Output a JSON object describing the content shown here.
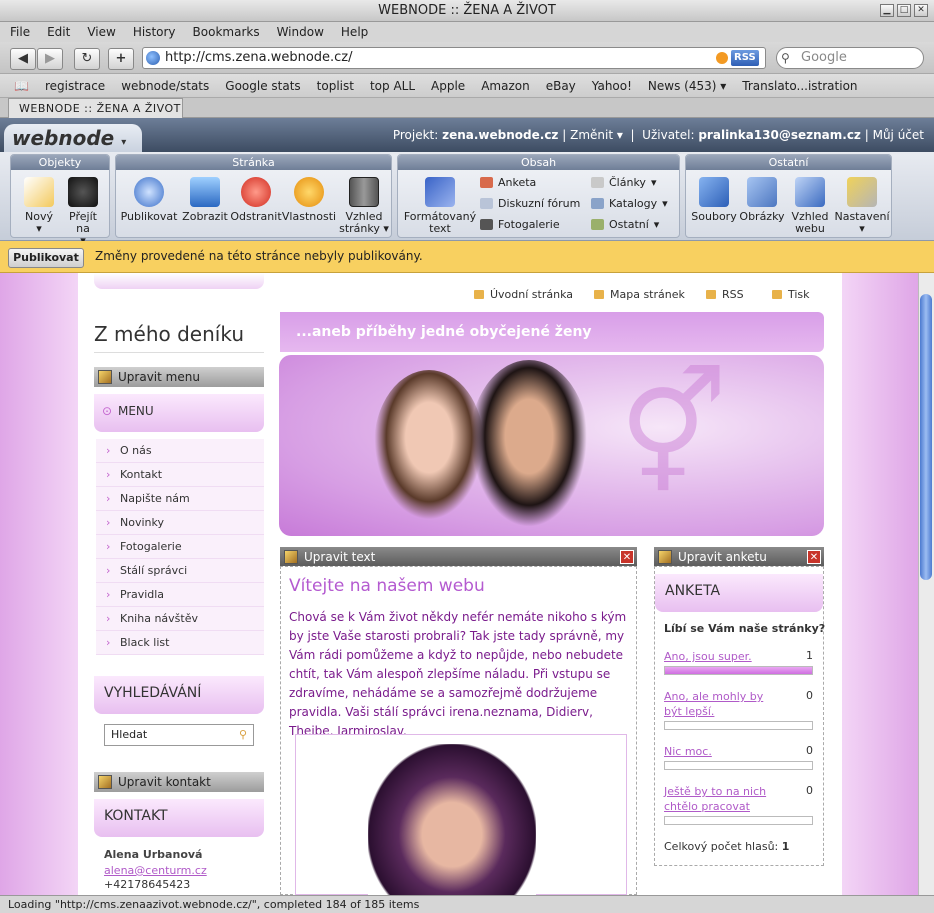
{
  "window": {
    "title": "WEBNODE :: ŽENA A ŽIVOT"
  },
  "menubar": [
    "File",
    "Edit",
    "View",
    "History",
    "Bookmarks",
    "Window",
    "Help"
  ],
  "nav": {
    "url": "http://cms.zena.webnode.cz/",
    "rss": "RSS",
    "search_placeholder": "Google"
  },
  "bookmarks": [
    "registrace",
    "webnode/stats",
    "Google stats",
    "toplist",
    "top ALL",
    "Apple",
    "Amazon",
    "eBay",
    "Yahoo!",
    "News (453) ▾",
    "Translato...istration"
  ],
  "tab": {
    "label": "WEBNODE :: ŽENA A ŽIVOT"
  },
  "webnode": {
    "logo": "webnode",
    "project_label": "Projekt:",
    "project": "zena.webnode.cz",
    "change": "Změnit",
    "user_label": "Uživatel:",
    "user": "pralinka130@seznam.cz",
    "account": "Můj účet"
  },
  "ribbon": {
    "objekty": {
      "title": "Objekty",
      "items": [
        "Nový",
        "Přejít na"
      ]
    },
    "stranka": {
      "title": "Stránka",
      "items": [
        "Publikovat",
        "Zobrazit",
        "Odstranit",
        "Vlastnosti",
        "Vzhled stránky"
      ]
    },
    "obsah": {
      "title": "Obsah",
      "big": "Formátovaný text",
      "col1": [
        "Anketa",
        "Diskuzní fórum",
        "Fotogalerie"
      ],
      "col2": [
        "Články",
        "Katalogy",
        "Ostatní"
      ]
    },
    "ostatni": {
      "title": "Ostatní",
      "items": [
        "Soubory",
        "Obrázky",
        "Vzhled webu",
        "Nastavení"
      ]
    }
  },
  "notice": {
    "button": "Publikovat",
    "text": "Změny provedené na této stránce nebyly publikovány."
  },
  "site": {
    "toplinks": [
      "Úvodní stránka",
      "Mapa stránek",
      "RSS",
      "Tisk"
    ],
    "title": "Z mého deníku",
    "slogan": "...aneb příběhy jedné obyčejené ženy",
    "edit_menu": "Upravit menu",
    "menu_title": "MENU",
    "menu": [
      "O nás",
      "Kontakt",
      "Napište nám",
      "Novinky",
      "Fotogalerie",
      "Stálí správci",
      "Pravidla",
      "Kniha návštěv",
      "Black list"
    ],
    "search_title": "VYHLEDÁVÁNÍ",
    "search_value": "Hledat",
    "edit_contact": "Upravit kontakt",
    "contact_title": "KONTAKT",
    "contact_name": "Alena Urbanová",
    "contact_email": "alena@centurm.cz",
    "contact_phone": "+42178645423",
    "edit_text": "Upravit text",
    "welcome": "Vítejte na našem webu",
    "body": "Chová se k Vám život někdy nefér nemáte nikoho s kým by jste Vaše starosti probrali? Tak jste tady správně, my Vám rádi pomůžeme a když to nepůjde, nebo nebudete chtít, tak Vám  alespoň zlepšíme náladu. Při vstupu se  zdravíme, nehádáme se a samozřejmě dodržujeme  pravidla. Vaši stálí správci irena.neznama,   Didierv, Theibe, Jarmiroslav.",
    "edit_poll": "Upravit anketu",
    "poll_title": "ANKETA",
    "poll_question": "Líbí se Vám naše stránky?",
    "poll_options": [
      {
        "label": "Ano, jsou super.",
        "count": "1",
        "fraction": 1.0
      },
      {
        "label": "Ano, ale mohly by být lepší.",
        "count": "0",
        "fraction": 0
      },
      {
        "label": "Nic moc.",
        "count": "0",
        "fraction": 0
      },
      {
        "label": "Ještě by to na nich chtělo pracovat",
        "count": "0",
        "fraction": 0
      }
    ],
    "poll_total_label": "Celkový počet hlasů:",
    "poll_total": "1"
  },
  "status": "Loading \"http://cms.zenaazivot.webnode.cz/\", completed 184 of 185 items"
}
